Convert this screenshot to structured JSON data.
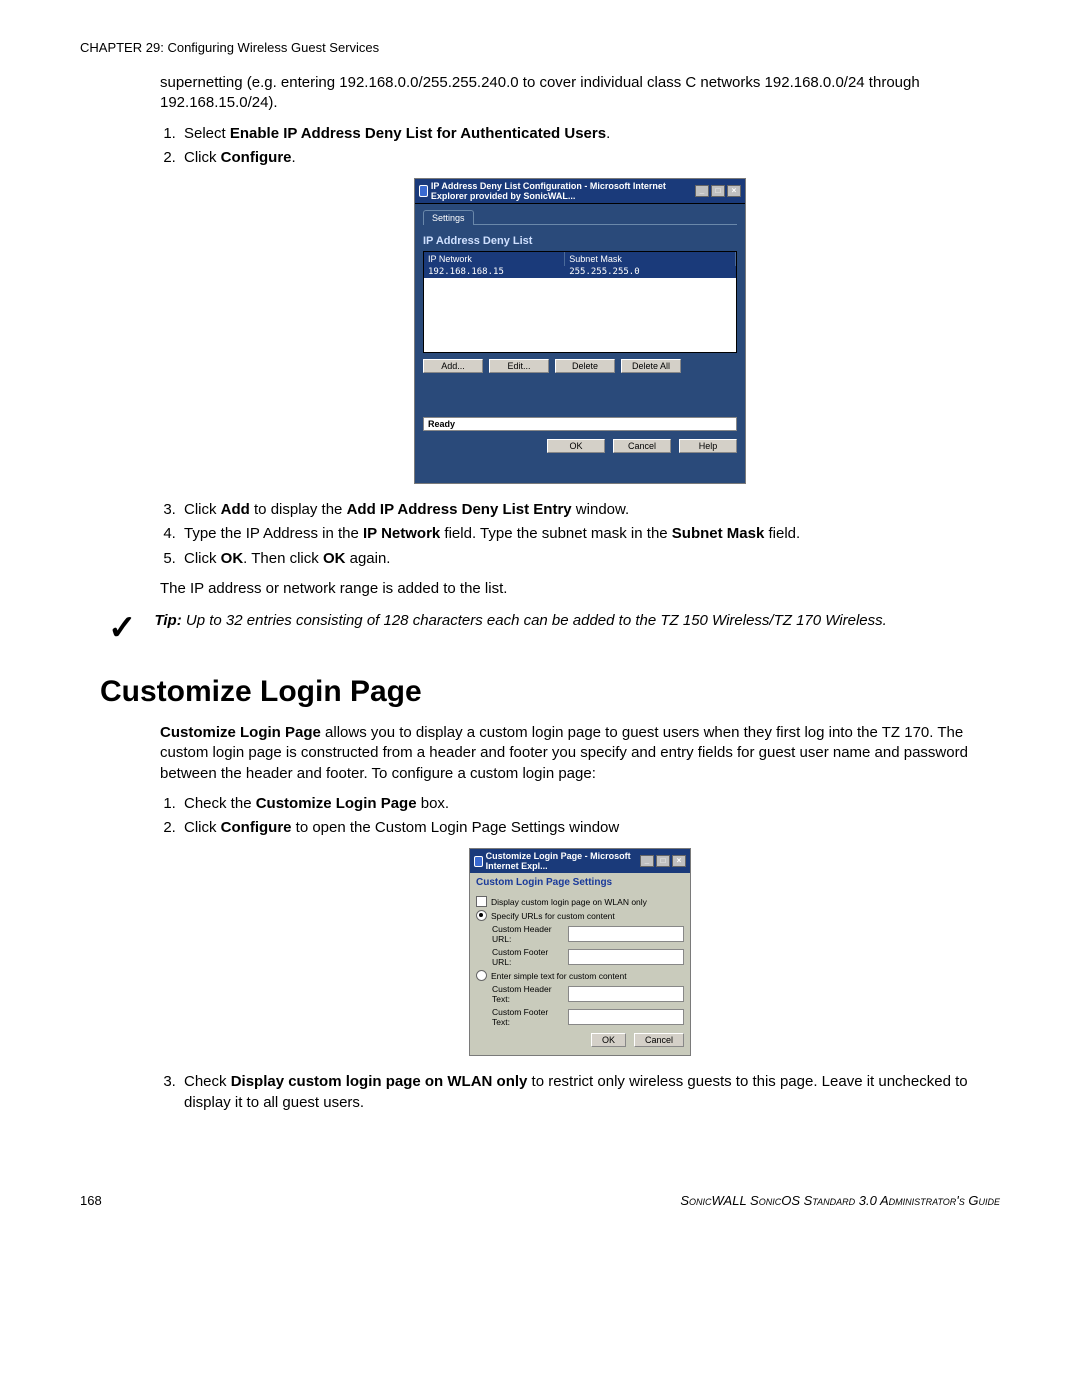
{
  "chapter": {
    "label": "CHAPTER",
    "num": "29",
    "title": "Configuring Wireless Guest Services"
  },
  "supernet_text": "supernetting (e.g. entering 192.168.0.0/255.255.240.0 to cover individual class C networks 192.168.0.0/24 through 192.168.15.0/24).",
  "steps1": {
    "s1_a": "Select ",
    "s1_b": "Enable IP Address Deny List for Authenticated Users",
    "s1_c": ".",
    "s2_a": "Click ",
    "s2_b": "Configure",
    "s2_c": "."
  },
  "ss1": {
    "title": "IP Address Deny List Configuration - Microsoft Internet Explorer provided by SonicWAL...",
    "tab": "Settings",
    "subhead": "IP Address Deny List",
    "col_ip": "IP Network",
    "col_mask": "Subnet Mask",
    "row_ip": "192.168.168.15",
    "row_mask": "255.255.255.0",
    "btn_add": "Add...",
    "btn_edit": "Edit...",
    "btn_del": "Delete",
    "btn_delall": "Delete All",
    "status": "Ready",
    "btn_ok": "OK",
    "btn_cancel": "Cancel",
    "btn_help": "Help"
  },
  "steps2": {
    "s3_a": "Click ",
    "s3_b": "Add",
    "s3_c": " to display the ",
    "s3_d": "Add IP Address Deny List Entry",
    "s3_e": " window.",
    "s4_a": "Type the IP Address in the ",
    "s4_b": "IP Network",
    "s4_c": " field. Type the subnet mask in the ",
    "s4_d": "Subnet Mask",
    "s4_e": " field.",
    "s5_a": "Click ",
    "s5_b": "OK",
    "s5_c": ". Then click ",
    "s5_d": "OK",
    "s5_e": " again."
  },
  "added_text": "The IP address or network range is added to the list.",
  "tip": {
    "prefix": "Tip:",
    "body": "Up to 32 entries consisting of 128 characters each can be added to the TZ 150 Wireless/TZ 170 Wireless."
  },
  "section": "Customize Login Page",
  "clp_text": {
    "b1": "Customize Login Page",
    "rest": " allows you to display a custom login page to guest users when they first log into the TZ 170. The custom login page is constructed from a header and footer you specify and entry fields for guest user name and password between the header and footer. To configure a custom login page:"
  },
  "steps3": {
    "s1_a": "Check the ",
    "s1_b": "Customize Login Page",
    "s1_c": " box.",
    "s2_a": "Click ",
    "s2_b": "Configure",
    "s2_c": " to open the Custom Login Page Settings window"
  },
  "ss2": {
    "title": "Customize Login Page - Microsoft Internet Expl...",
    "head": "Custom Login Page Settings",
    "opt1": "Display custom login page on WLAN only",
    "opt2": "Specify URLs for custom content",
    "hurl": "Custom Header URL:",
    "furl": "Custom Footer URL:",
    "opt3": "Enter simple text for custom content",
    "htext": "Custom Header Text:",
    "ftext": "Custom Footer Text:",
    "ok": "OK",
    "cancel": "Cancel"
  },
  "steps4": {
    "s3_a": "Check ",
    "s3_b": "Display custom login page on WLAN only",
    "s3_c": " to restrict only wireless guests to this page. Leave it unchecked to display it to all guest users."
  },
  "footer": {
    "page": "168",
    "guide": "SonicWALL SonicOS Standard 3.0 Administrator's Guide"
  }
}
